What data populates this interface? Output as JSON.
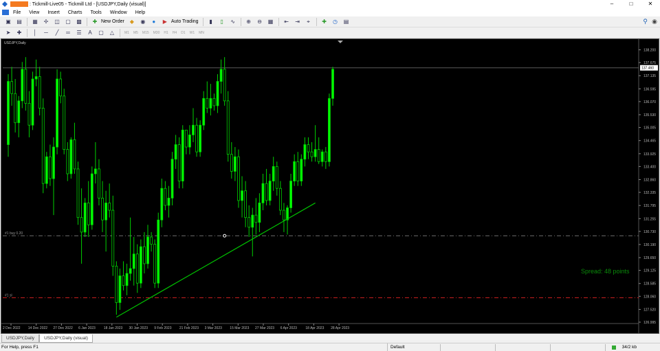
{
  "window": {
    "title": ": Tickmill-Live05 - Tickmill Ltd - [USDJPY,Daily (visual)]",
    "min": "–",
    "max": "□",
    "close": "✕"
  },
  "menu": {
    "items": [
      "File",
      "View",
      "Insert",
      "Charts",
      "Tools",
      "Window",
      "Help"
    ],
    "mdi_min": "–",
    "mdi_restore": "▣",
    "mdi_close": "✕"
  },
  "toolbar": {
    "new_order": "New Order",
    "auto_trading": "Auto Trading",
    "timeframes": [
      "M1",
      "M5",
      "M15",
      "M30",
      "H1",
      "H4",
      "D1",
      "W1",
      "MN"
    ]
  },
  "chart": {
    "symbol_title": "USDJPY,Daily",
    "spread_text": "Spread: 48 points",
    "buy_line_label": "#1 buy 0.20",
    "sl_line_label": "#1 sl",
    "current_price": "137.460",
    "colors": {
      "background": "#000000",
      "bull_candle": "#00ff00",
      "bear_candle": "#000000",
      "wick": "#00d000",
      "trendline": "#00c000",
      "buy_line": "#6e6e6e",
      "sl_line": "#c81e1e",
      "spread_text": "#0a8c0a",
      "bid_line": "#5a5a5a"
    },
    "price_labels": [
      "138.200",
      "137.675",
      "137.135",
      "136.595",
      "136.070",
      "135.530",
      "135.005",
      "134.465",
      "133.925",
      "133.400",
      "132.860",
      "132.335",
      "131.795",
      "131.255",
      "130.730",
      "130.190",
      "129.650",
      "129.125",
      "128.585",
      "128.060",
      "127.520",
      "126.995"
    ],
    "date_labels": [
      "2 Dec 2022",
      "14 Dec 2022",
      "27 Dec 2022",
      "6 Jan 2023",
      "18 Jan 2023",
      "30 Jan 2023",
      "9 Feb 2023",
      "21 Feb 2023",
      "3 Mar 2023",
      "15 Mar 2023",
      "27 Mar 2023",
      "6 Apr 2023",
      "18 Apr 2023",
      "28 Apr 2023"
    ]
  },
  "chart_data": {
    "type": "candlestick",
    "symbol": "USDJPY",
    "timeframe": "Daily",
    "ylim": [
      126.995,
      138.3
    ],
    "candles": [
      {
        "o": 134.3,
        "h": 137.2,
        "l": 133.8,
        "c": 136.9
      },
      {
        "o": 136.9,
        "h": 137.5,
        "l": 135.9,
        "c": 136.4
      },
      {
        "o": 136.4,
        "h": 137.0,
        "l": 134.8,
        "c": 135.2
      },
      {
        "o": 135.2,
        "h": 136.3,
        "l": 134.6,
        "c": 136.1
      },
      {
        "o": 136.1,
        "h": 137.7,
        "l": 135.8,
        "c": 137.4
      },
      {
        "o": 137.4,
        "h": 137.9,
        "l": 135.7,
        "c": 136.0
      },
      {
        "o": 136.0,
        "h": 136.5,
        "l": 134.6,
        "c": 135.1
      },
      {
        "o": 135.1,
        "h": 137.3,
        "l": 134.9,
        "c": 137.0
      },
      {
        "o": 137.0,
        "h": 137.8,
        "l": 136.7,
        "c": 137.1
      },
      {
        "o": 137.1,
        "h": 137.5,
        "l": 135.5,
        "c": 135.8
      },
      {
        "o": 135.8,
        "h": 136.2,
        "l": 132.3,
        "c": 132.7
      },
      {
        "o": 132.7,
        "h": 134.0,
        "l": 132.5,
        "c": 133.8
      },
      {
        "o": 133.8,
        "h": 134.3,
        "l": 132.6,
        "c": 132.9
      },
      {
        "o": 132.9,
        "h": 134.6,
        "l": 131.4,
        "c": 134.2
      },
      {
        "o": 134.2,
        "h": 137.4,
        "l": 133.9,
        "c": 137.0
      },
      {
        "o": 137.0,
        "h": 137.3,
        "l": 136.0,
        "c": 136.3
      },
      {
        "o": 136.3,
        "h": 136.6,
        "l": 133.9,
        "c": 134.1
      },
      {
        "o": 134.1,
        "h": 134.4,
        "l": 132.8,
        "c": 133.1
      },
      {
        "o": 133.1,
        "h": 134.6,
        "l": 132.9,
        "c": 134.5
      },
      {
        "o": 134.5,
        "h": 135.2,
        "l": 133.1,
        "c": 133.3
      },
      {
        "o": 133.3,
        "h": 133.6,
        "l": 131.0,
        "c": 131.3
      },
      {
        "o": 131.3,
        "h": 132.5,
        "l": 129.4,
        "c": 130.7
      },
      {
        "o": 130.7,
        "h": 132.1,
        "l": 130.5,
        "c": 131.9
      },
      {
        "o": 131.9,
        "h": 132.8,
        "l": 130.5,
        "c": 131.0
      },
      {
        "o": 131.0,
        "h": 133.4,
        "l": 130.8,
        "c": 133.1
      },
      {
        "o": 133.1,
        "h": 134.4,
        "l": 132.7,
        "c": 133.3
      },
      {
        "o": 133.3,
        "h": 133.7,
        "l": 131.8,
        "c": 132.1
      },
      {
        "o": 132.1,
        "h": 132.8,
        "l": 130.7,
        "c": 131.2
      },
      {
        "o": 131.2,
        "h": 132.4,
        "l": 129.9,
        "c": 131.9
      },
      {
        "o": 131.9,
        "h": 132.7,
        "l": 131.3,
        "c": 131.6
      },
      {
        "o": 131.6,
        "h": 132.2,
        "l": 128.9,
        "c": 129.3
      },
      {
        "o": 129.3,
        "h": 129.5,
        "l": 127.3,
        "c": 127.8
      },
      {
        "o": 127.8,
        "h": 129.2,
        "l": 127.5,
        "c": 128.9
      },
      {
        "o": 128.9,
        "h": 129.5,
        "l": 128.3,
        "c": 128.5
      },
      {
        "o": 128.5,
        "h": 129.4,
        "l": 128.1,
        "c": 129.0
      },
      {
        "o": 129.0,
        "h": 131.3,
        "l": 128.7,
        "c": 129.2
      },
      {
        "o": 129.2,
        "h": 130.5,
        "l": 128.5,
        "c": 129.8
      },
      {
        "o": 129.8,
        "h": 130.2,
        "l": 128.2,
        "c": 128.6
      },
      {
        "o": 128.6,
        "h": 130.4,
        "l": 128.4,
        "c": 130.1
      },
      {
        "o": 130.1,
        "h": 130.7,
        "l": 129.0,
        "c": 129.4
      },
      {
        "o": 129.4,
        "h": 131.0,
        "l": 129.2,
        "c": 130.5
      },
      {
        "o": 130.5,
        "h": 130.7,
        "l": 129.9,
        "c": 130.2
      },
      {
        "o": 130.2,
        "h": 130.4,
        "l": 128.4,
        "c": 128.6
      },
      {
        "o": 128.6,
        "h": 131.5,
        "l": 128.4,
        "c": 131.2
      },
      {
        "o": 131.2,
        "h": 132.9,
        "l": 130.9,
        "c": 132.5
      },
      {
        "o": 132.5,
        "h": 132.8,
        "l": 131.6,
        "c": 131.8
      },
      {
        "o": 131.8,
        "h": 132.6,
        "l": 131.3,
        "c": 132.1
      },
      {
        "o": 132.1,
        "h": 134.0,
        "l": 131.8,
        "c": 133.7
      },
      {
        "o": 133.7,
        "h": 134.7,
        "l": 133.3,
        "c": 134.3
      },
      {
        "o": 134.3,
        "h": 134.6,
        "l": 132.5,
        "c": 132.8
      },
      {
        "o": 132.8,
        "h": 135.1,
        "l": 132.5,
        "c": 134.9
      },
      {
        "o": 134.9,
        "h": 134.9,
        "l": 133.9,
        "c": 134.2
      },
      {
        "o": 134.2,
        "h": 135.1,
        "l": 133.9,
        "c": 134.7
      },
      {
        "o": 134.7,
        "h": 135.8,
        "l": 134.4,
        "c": 135.1
      },
      {
        "o": 135.1,
        "h": 135.4,
        "l": 133.8,
        "c": 134.0
      },
      {
        "o": 134.0,
        "h": 135.3,
        "l": 133.8,
        "c": 135.1
      },
      {
        "o": 135.1,
        "h": 136.5,
        "l": 134.9,
        "c": 136.2
      },
      {
        "o": 136.2,
        "h": 136.9,
        "l": 135.6,
        "c": 135.8
      },
      {
        "o": 135.8,
        "h": 136.8,
        "l": 135.5,
        "c": 136.2
      },
      {
        "o": 136.2,
        "h": 136.4,
        "l": 135.7,
        "c": 135.9
      },
      {
        "o": 135.9,
        "h": 137.2,
        "l": 135.6,
        "c": 136.9
      },
      {
        "o": 136.9,
        "h": 137.8,
        "l": 136.4,
        "c": 137.4
      },
      {
        "o": 137.4,
        "h": 137.9,
        "l": 135.9,
        "c": 136.1
      },
      {
        "o": 136.1,
        "h": 136.5,
        "l": 133.6,
        "c": 133.9
      },
      {
        "o": 133.9,
        "h": 134.4,
        "l": 132.9,
        "c": 133.2
      },
      {
        "o": 133.2,
        "h": 134.2,
        "l": 132.8,
        "c": 133.8
      },
      {
        "o": 133.8,
        "h": 134.1,
        "l": 131.7,
        "c": 132.0
      },
      {
        "o": 132.0,
        "h": 133.0,
        "l": 131.3,
        "c": 132.4
      },
      {
        "o": 132.4,
        "h": 132.8,
        "l": 130.9,
        "c": 131.3
      },
      {
        "o": 131.3,
        "h": 131.8,
        "l": 130.5,
        "c": 130.9
      },
      {
        "o": 130.9,
        "h": 131.7,
        "l": 129.7,
        "c": 131.4
      },
      {
        "o": 131.4,
        "h": 132.1,
        "l": 130.6,
        "c": 131.1
      },
      {
        "o": 131.1,
        "h": 132.3,
        "l": 130.7,
        "c": 131.9
      },
      {
        "o": 131.9,
        "h": 133.1,
        "l": 131.6,
        "c": 132.7
      },
      {
        "o": 132.7,
        "h": 133.3,
        "l": 131.8,
        "c": 132.0
      },
      {
        "o": 132.0,
        "h": 133.1,
        "l": 131.8,
        "c": 132.8
      },
      {
        "o": 132.8,
        "h": 133.8,
        "l": 132.4,
        "c": 133.4
      },
      {
        "o": 133.4,
        "h": 133.6,
        "l": 132.2,
        "c": 132.5
      },
      {
        "o": 132.5,
        "h": 132.8,
        "l": 131.4,
        "c": 131.6
      },
      {
        "o": 131.6,
        "h": 131.9,
        "l": 130.7,
        "c": 131.2
      },
      {
        "o": 131.2,
        "h": 131.8,
        "l": 130.6,
        "c": 131.7
      },
      {
        "o": 131.7,
        "h": 133.1,
        "l": 131.5,
        "c": 132.8
      },
      {
        "o": 132.8,
        "h": 133.9,
        "l": 132.6,
        "c": 133.6
      },
      {
        "o": 133.6,
        "h": 134.0,
        "l": 132.6,
        "c": 132.8
      },
      {
        "o": 132.8,
        "h": 133.9,
        "l": 132.6,
        "c": 133.7
      },
      {
        "o": 133.7,
        "h": 134.6,
        "l": 133.4,
        "c": 134.3
      },
      {
        "o": 134.3,
        "h": 134.6,
        "l": 133.7,
        "c": 134.0
      },
      {
        "o": 134.0,
        "h": 134.4,
        "l": 133.6,
        "c": 133.8
      },
      {
        "o": 133.8,
        "h": 135.1,
        "l": 133.6,
        "c": 134.1
      },
      {
        "o": 134.1,
        "h": 134.6,
        "l": 133.5,
        "c": 133.6
      },
      {
        "o": 133.6,
        "h": 134.1,
        "l": 133.4,
        "c": 134.0
      },
      {
        "o": 134.0,
        "h": 134.2,
        "l": 133.3,
        "c": 133.6
      },
      {
        "o": 133.6,
        "h": 136.4,
        "l": 133.4,
        "c": 136.2
      },
      {
        "o": 136.2,
        "h": 137.5,
        "l": 135.9,
        "c": 137.4
      }
    ],
    "trendline": {
      "from": {
        "index": 31,
        "price": 127.2
      },
      "to": {
        "index": 88,
        "price": 131.9
      }
    },
    "lines": [
      {
        "label": "#1 buy 0.20",
        "price": 130.55,
        "style": "dash-dot"
      },
      {
        "label": "#1 sl",
        "price": 128.0,
        "style": "dash-dot"
      },
      {
        "label": "bid",
        "price": 137.46,
        "style": "solid"
      }
    ],
    "xlabel": "",
    "ylabel": ""
  },
  "tabs": [
    "USDJPY,Daily",
    "USDJPY,Daily (visual)"
  ],
  "status": {
    "help": "For Help, press F1",
    "profile": "Default",
    "traffic": "34/2 kb"
  }
}
